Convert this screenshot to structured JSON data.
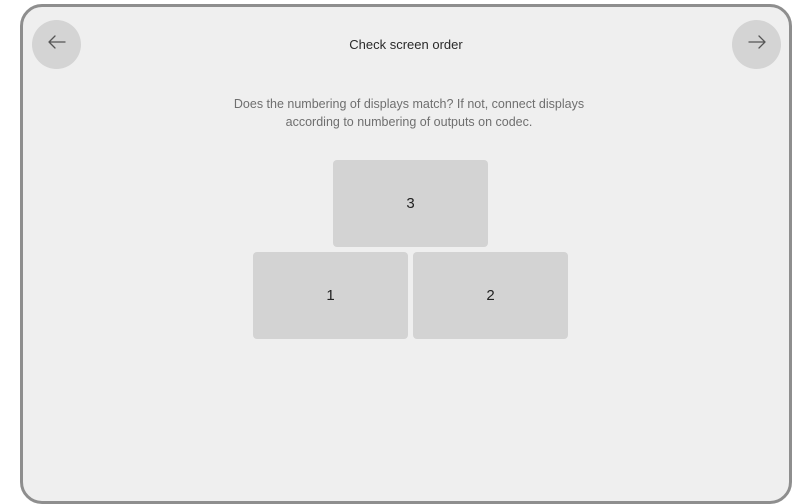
{
  "header": {
    "title": "Check screen order",
    "back_icon": "arrow-left-icon",
    "next_icon": "arrow-right-icon"
  },
  "instructions": {
    "line1": "Does the numbering of displays match? If not, connect displays",
    "line2": "according to numbering of outputs on codec."
  },
  "screens": [
    {
      "label": "3"
    },
    {
      "label": "1"
    },
    {
      "label": "2"
    }
  ],
  "colors": {
    "background": "#efefef",
    "screen_fill": "#d3d3d3",
    "nav_button": "#d4d4d4",
    "frame_border": "#8e8e8e"
  }
}
